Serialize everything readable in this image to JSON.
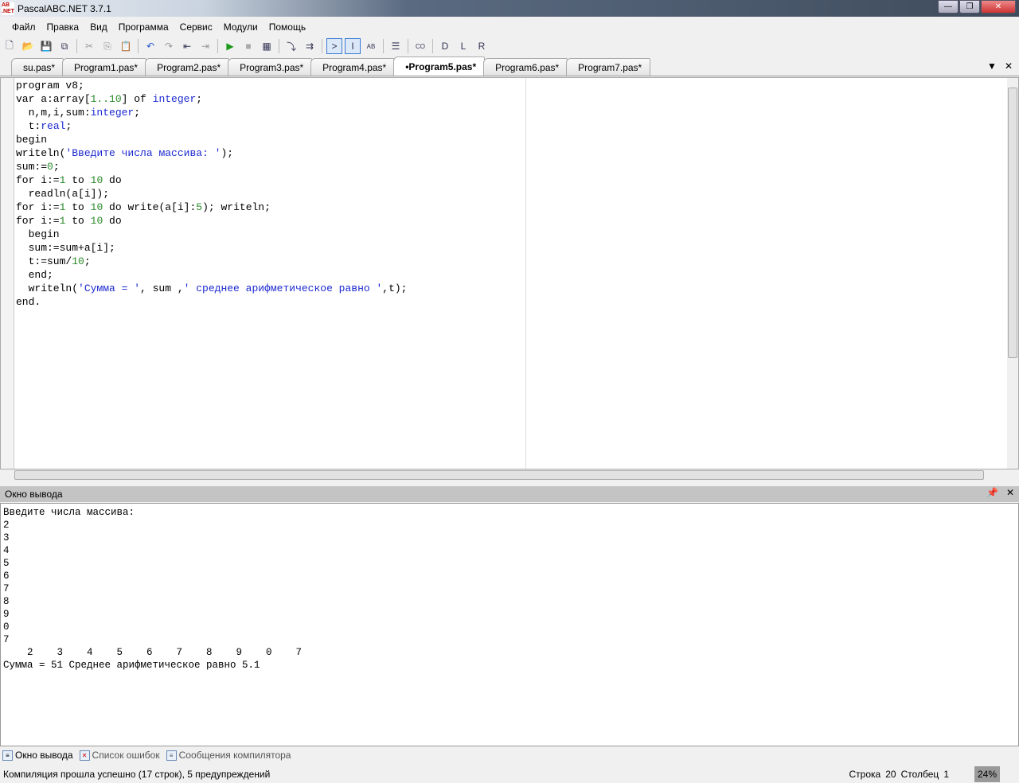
{
  "window": {
    "title": "PascalABC.NET 3.7.1"
  },
  "menu": [
    "Файл",
    "Правка",
    "Вид",
    "Программа",
    "Сервис",
    "Модули",
    "Помощь"
  ],
  "tabs": [
    "su.pas*",
    "Program1.pas*",
    "Program2.pas*",
    "Program3.pas*",
    "Program4.pas*",
    "•Program5.pas*",
    "Program6.pas*",
    "Program7.pas*"
  ],
  "active_tab": 5,
  "code": [
    [
      [
        "kw",
        "program v8;"
      ]
    ],
    [
      [
        "kw",
        "var a:array["
      ],
      [
        "nu",
        "1..10"
      ],
      [
        "kw",
        "] of "
      ],
      [
        "ty",
        "integer"
      ],
      [
        "kw",
        ";"
      ]
    ],
    [
      [
        "kw",
        "  n,m,i,sum:"
      ],
      [
        "ty",
        "integer"
      ],
      [
        "kw",
        ";"
      ]
    ],
    [
      [
        "kw",
        "  t:"
      ],
      [
        "ty",
        "real"
      ],
      [
        "kw",
        ";"
      ]
    ],
    [
      [
        "kw",
        "begin"
      ]
    ],
    [
      [
        "kw",
        "writeln("
      ],
      [
        "st",
        "'Введите числа массива: '"
      ],
      [
        "kw",
        ");"
      ]
    ],
    [
      [
        "kw",
        "sum:="
      ],
      [
        "nu",
        "0"
      ],
      [
        "kw",
        ";"
      ]
    ],
    [
      [
        "kw",
        "for i:="
      ],
      [
        "nu",
        "1"
      ],
      [
        "kw",
        " to "
      ],
      [
        "nu",
        "10"
      ],
      [
        "kw",
        " do"
      ]
    ],
    [
      [
        "kw",
        "  readln(a[i]);"
      ]
    ],
    [
      [
        "kw",
        "for i:="
      ],
      [
        "nu",
        "1"
      ],
      [
        "kw",
        " to "
      ],
      [
        "nu",
        "10"
      ],
      [
        "kw",
        " do write(a[i]:"
      ],
      [
        "nu",
        "5"
      ],
      [
        "kw",
        "); writeln;"
      ]
    ],
    [
      [
        "kw",
        "for i:="
      ],
      [
        "nu",
        "1"
      ],
      [
        "kw",
        " to "
      ],
      [
        "nu",
        "10"
      ],
      [
        "kw",
        " do"
      ]
    ],
    [
      [
        "kw",
        "  begin"
      ]
    ],
    [
      [
        "kw",
        "  sum:=sum+a[i];"
      ]
    ],
    [
      [
        "kw",
        "  t:=sum/"
      ],
      [
        "nu",
        "10"
      ],
      [
        "kw",
        ";"
      ]
    ],
    [
      [
        "kw",
        "  end;"
      ]
    ],
    [
      [
        "kw",
        "  writeln("
      ],
      [
        "st",
        "'Сумма = '"
      ],
      [
        "kw",
        ", sum ,"
      ],
      [
        "st",
        "' среднее арифметическое равно '"
      ],
      [
        "kw",
        ",t);"
      ]
    ],
    [
      [
        "kw",
        "end."
      ]
    ]
  ],
  "output": {
    "title": "Окно вывода",
    "lines": [
      "Введите числа массива: ",
      "2",
      "3",
      "4",
      "5",
      "6",
      "7",
      "8",
      "9",
      "0",
      "7",
      "    2    3    4    5    6    7    8    9    0    7",
      "Сумма = 51 Среднее арифметическое равно 5.1"
    ]
  },
  "bottom_tabs": [
    "Окно вывода",
    "Список ошибок",
    "Сообщения компилятора"
  ],
  "status": {
    "message": "Компиляция прошла успешно (17 строк), 5 предупреждений",
    "row_label": "Строка",
    "row": "20",
    "col_label": "Столбец",
    "col": "1",
    "zoom": "24%"
  }
}
